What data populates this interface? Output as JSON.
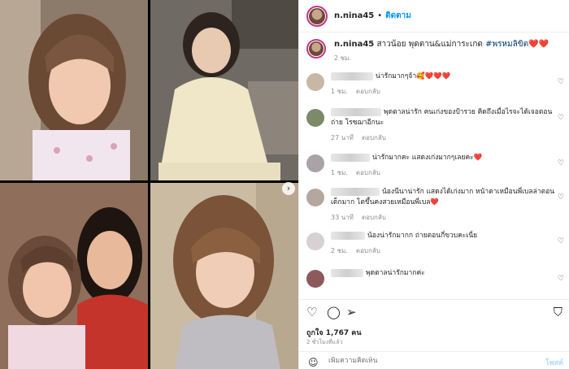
{
  "header": {
    "username": "n.nina45",
    "separator": "•",
    "follow_label": "ติดตาม"
  },
  "caption": {
    "username": "n.nina45",
    "text": "สาวน้อย พุดตาน&แม่การะเกด",
    "hashtag": "#พรหมลิขิต",
    "emoji": "❤️❤️",
    "time": "2 ชม."
  },
  "comments": [
    {
      "text": "น่ารักมากๆจ้า🥰❤️❤️❤️",
      "time": "1 ชม.",
      "reply": "ตอบกลับ",
      "avatar_color": "#c9b7a6"
    },
    {
      "text": "พุดตาลน่ารัก คนเก่งของป้ารวย คิดถึงเมื่อไรจะได้เจอตอนถ่าย โรซฌาอีกนะ",
      "time": "27 นาที",
      "reply": "ตอบกลับ",
      "avatar_color": "#7d8a6a"
    },
    {
      "text": "น่ารักมากคะ แสดงเก่งมากๆเลยคะ❤️",
      "time": "1 ชม.",
      "reply": "ตอบกลับ",
      "avatar_color": "#a9a3a7"
    },
    {
      "text": "น้องนีนาน่ารัก แสดงได้เก่งมาก หน้าตาเหมือนพี่เบลล่าตอนเด็กมาก โตขึ้นคงสวยเหมือนพี่เบล❤️",
      "time": "33 นาที",
      "reply": "ตอบกลับ",
      "avatar_color": "#b5a79d"
    },
    {
      "text": "น้องน่ารักมากก ถ่ายตอนกี่ขวบคะเนี่ย",
      "time": "2 ชม.",
      "reply": "ตอบกลับ",
      "avatar_color": "#d7d1d3"
    },
    {
      "text": "พุดตาลน่ารักมากค่ะ",
      "time": "",
      "reply": "",
      "avatar_color": "#8c5a5d"
    }
  ],
  "actions": {
    "like_icon": "heart-outline-icon",
    "comment_icon": "comment-icon",
    "share_icon": "send-icon",
    "save_icon": "bookmark-icon"
  },
  "likes": "ถูกใจ 1,767 คน",
  "posted_ago": "2 ชั่วโมงที่แล้ว",
  "add_comment": {
    "placeholder": "เพิ่มความคิดเห็น",
    "post_label": "โพสต์"
  },
  "colors": {
    "link_blue": "#0095f6",
    "heart_red": "#e0245e",
    "muted": "#8e8e8e"
  }
}
